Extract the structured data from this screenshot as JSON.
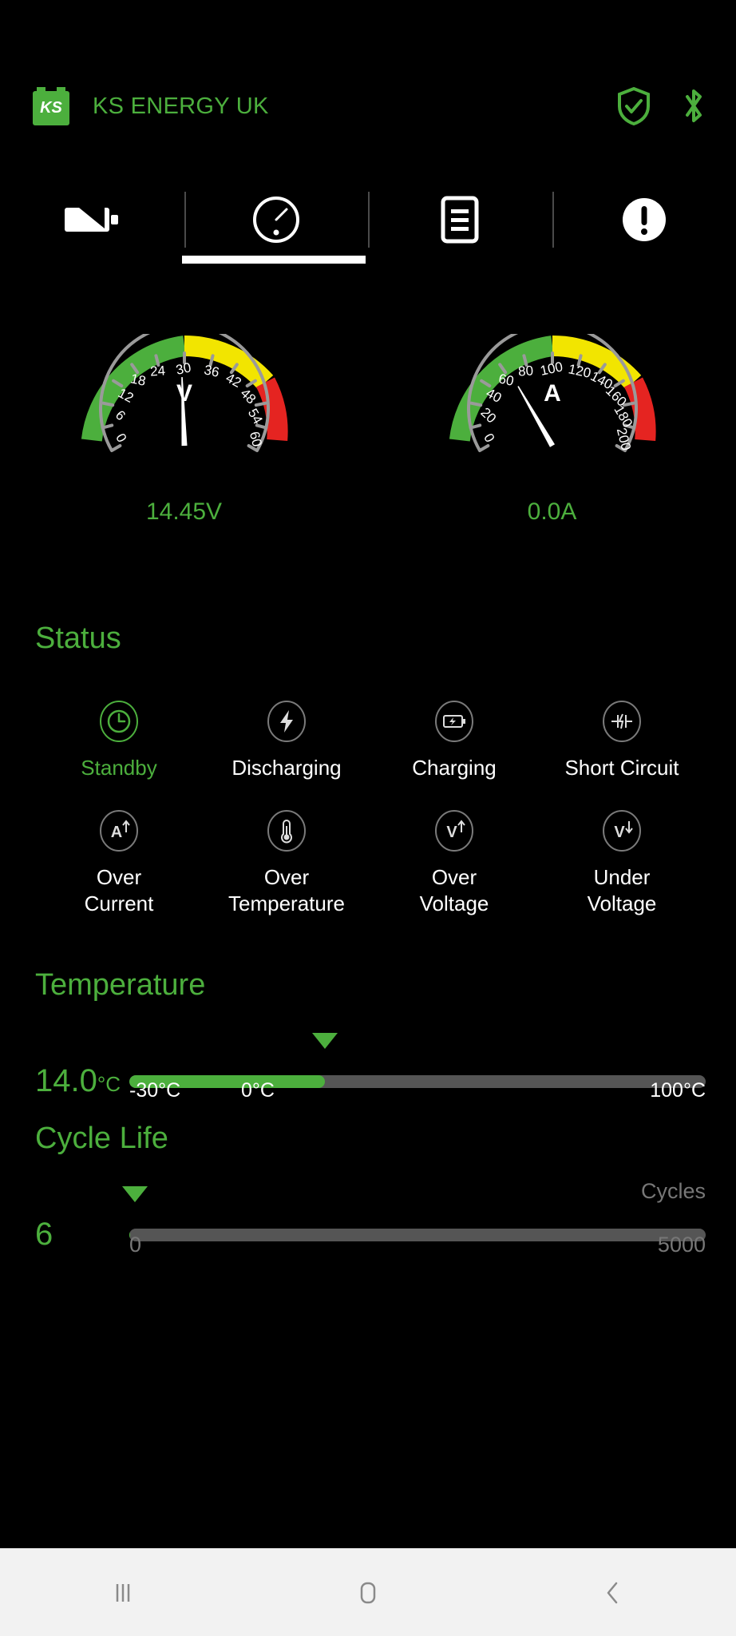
{
  "header": {
    "logo_text": "KS",
    "logo_icon": "battery-logo-icon",
    "title": "KS ENERGY UK",
    "shield_icon": "shield-check-icon",
    "bluetooth_icon": "bluetooth-icon",
    "accent_color": "#4caf3d"
  },
  "tabs": [
    {
      "name": "battery",
      "icon": "battery-icon",
      "active": false
    },
    {
      "name": "gauge",
      "icon": "gauge-icon",
      "active": true
    },
    {
      "name": "records",
      "icon": "list-document-icon",
      "active": false
    },
    {
      "name": "alerts",
      "icon": "exclamation-circle-icon",
      "active": false
    }
  ],
  "gauges": {
    "voltage": {
      "unit_label": "V",
      "value_text": "14.45V",
      "value": 14.45,
      "min": 0,
      "max": 60,
      "tick_step": 6,
      "ticks": [
        0,
        6,
        12,
        18,
        24,
        30,
        36,
        42,
        48,
        54,
        60
      ],
      "zones": [
        {
          "color": "#4caf3d",
          "from": 0,
          "to": 30
        },
        {
          "color": "#f2e500",
          "from": 30,
          "to": 42
        },
        {
          "color": "#e52421",
          "from": 42,
          "to": 60
        }
      ]
    },
    "current": {
      "unit_label": "A",
      "value_text": "0.0A",
      "value": 0.0,
      "min": 0,
      "max": 200,
      "tick_step": 20,
      "ticks": [
        0,
        20,
        40,
        60,
        80,
        100,
        120,
        140,
        160,
        180,
        200
      ],
      "zones": [
        {
          "color": "#4caf3d",
          "from": 0,
          "to": 100
        },
        {
          "color": "#f2e500",
          "from": 100,
          "to": 140
        },
        {
          "color": "#e52421",
          "from": 140,
          "to": 200
        }
      ]
    }
  },
  "status": {
    "title": "Status",
    "items": [
      {
        "label": "Standby",
        "icon": "clock-icon",
        "active": true
      },
      {
        "label": "Discharging",
        "icon": "lightning-bolt-icon",
        "active": false
      },
      {
        "label": "Charging",
        "icon": "battery-charge-icon",
        "active": false
      },
      {
        "label": "Short Circuit",
        "icon": "short-circuit-icon",
        "active": false
      },
      {
        "label": "Over\nCurrent",
        "icon": "amp-up-icon",
        "active": false
      },
      {
        "label": "Over\nTemperature",
        "icon": "thermometer-icon",
        "active": false
      },
      {
        "label": "Over\nVoltage",
        "icon": "volt-up-icon",
        "active": false
      },
      {
        "label": "Under\nVoltage",
        "icon": "volt-down-icon",
        "active": false
      }
    ]
  },
  "temperature": {
    "title": "Temperature",
    "value_number": "14.0",
    "value_unit": "°C",
    "value": 14.0,
    "min": -30,
    "max": 100,
    "scale_labels": [
      "-30°C",
      "0°C",
      "100°C"
    ],
    "fill_percent": 34,
    "marker_percent": 34
  },
  "cycle_life": {
    "title": "Cycle Life",
    "value": "6",
    "value_number": 6,
    "min": 0,
    "max": 5000,
    "unit_label": "Cycles",
    "scale_min_label": "0",
    "scale_max_label": "5000",
    "fill_percent": 0.12,
    "marker_percent": 1
  },
  "navbar": {
    "recents_icon": "recents-icon",
    "home_icon": "home-icon",
    "back_icon": "back-icon"
  }
}
